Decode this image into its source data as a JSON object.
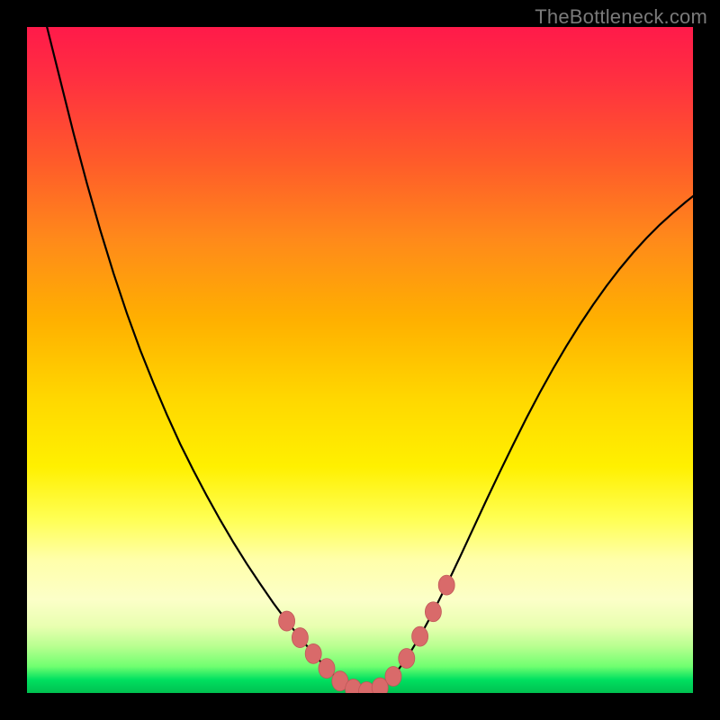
{
  "watermark": "TheBottleneck.com",
  "colors": {
    "frame": "#000000",
    "gradient_top": "#ff1a4a",
    "gradient_bottom": "#00c050",
    "curve": "#000000",
    "marker_fill": "#d96a6a",
    "marker_stroke": "#c05858"
  },
  "chart_data": {
    "type": "line",
    "title": "",
    "xlabel": "",
    "ylabel": "",
    "xlim": [
      0,
      100
    ],
    "ylim": [
      0,
      100
    ],
    "x": [
      3,
      5,
      7,
      9,
      11,
      13,
      15,
      17,
      19,
      21,
      23,
      25,
      27,
      29,
      31,
      33,
      35,
      37,
      39,
      41,
      43,
      45,
      47,
      49,
      51,
      53,
      55,
      57,
      59,
      61,
      63,
      65,
      67,
      69,
      71,
      73,
      75,
      77,
      79,
      81,
      83,
      85,
      87,
      89,
      91,
      93,
      95,
      97,
      99,
      100
    ],
    "y": [
      100,
      92,
      84,
      76.5,
      69.5,
      63,
      57,
      51.5,
      46.5,
      41.8,
      37.4,
      33.4,
      29.6,
      26,
      22.6,
      19.4,
      16.4,
      13.5,
      10.8,
      8.3,
      5.9,
      3.7,
      1.8,
      0.6,
      0.2,
      0.8,
      2.5,
      5.2,
      8.5,
      12.2,
      16.2,
      20.4,
      24.7,
      29,
      33.2,
      37.3,
      41.3,
      45.1,
      48.7,
      52.1,
      55.3,
      58.3,
      61.1,
      63.7,
      66.1,
      68.3,
      70.3,
      72.1,
      73.8,
      74.6
    ],
    "markers": {
      "x": [
        39,
        41,
        43,
        45,
        47,
        49,
        51,
        53,
        55,
        57,
        59,
        61,
        63
      ],
      "y": [
        10.8,
        8.3,
        5.9,
        3.7,
        1.8,
        0.6,
        0.2,
        0.8,
        2.5,
        5.2,
        8.5,
        12.2,
        16.2
      ]
    }
  }
}
